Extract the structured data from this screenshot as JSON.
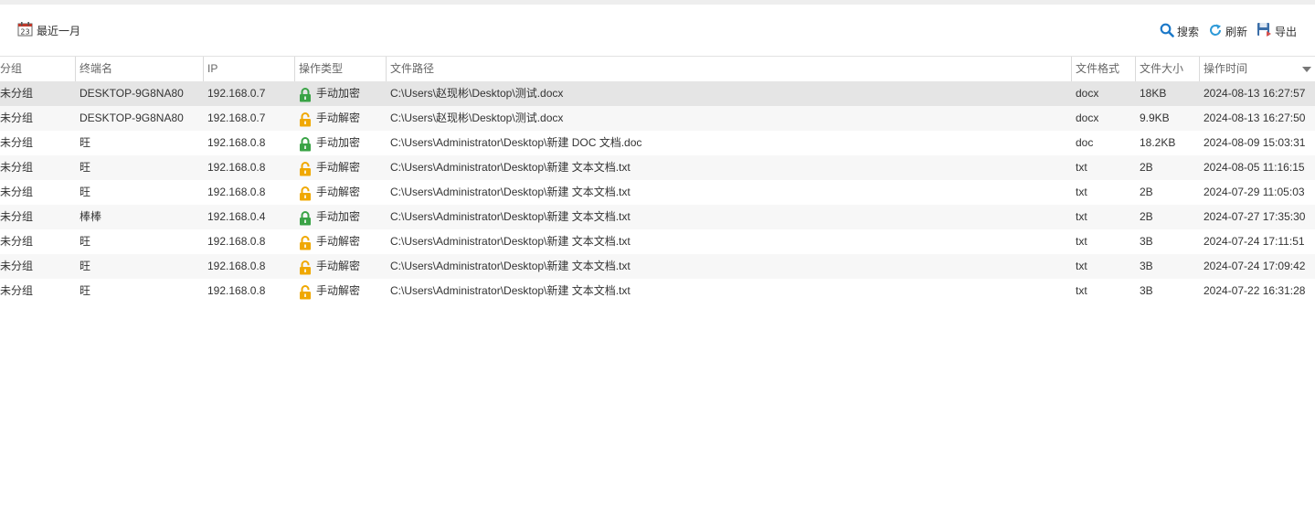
{
  "toolbar": {
    "period_label": "最近一月",
    "search_label": "搜索",
    "refresh_label": "刷新",
    "export_label": "导出"
  },
  "colors": {
    "encrypt_lock": "#3aa346",
    "decrypt_lock": "#f0a800",
    "search_icon": "#1b78c8",
    "refresh_icon": "#2e9ad8"
  },
  "table": {
    "columns": [
      "分组",
      "终端名",
      "IP",
      "操作类型",
      "文件路径",
      "文件格式",
      "文件大小",
      "操作时间"
    ],
    "sort_column": "操作时间",
    "rows": [
      {
        "group": "未分组",
        "terminal": "DESKTOP-9G8NA80",
        "ip": "192.168.0.7",
        "op": "手动加密",
        "op_icon": "lock-closed-green-icon",
        "path": "C:\\Users\\赵现彬\\Desktop\\测试.docx",
        "format": "docx",
        "size": "18KB",
        "time": "2024-08-13 16:27:57",
        "selected": true
      },
      {
        "group": "未分组",
        "terminal": "DESKTOP-9G8NA80",
        "ip": "192.168.0.7",
        "op": "手动解密",
        "op_icon": "lock-open-yellow-icon",
        "path": "C:\\Users\\赵现彬\\Desktop\\测试.docx",
        "format": "docx",
        "size": "9.9KB",
        "time": "2024-08-13 16:27:50"
      },
      {
        "group": "未分组",
        "terminal": "旺",
        "ip": "192.168.0.8",
        "op": "手动加密",
        "op_icon": "lock-closed-green-icon",
        "path": "C:\\Users\\Administrator\\Desktop\\新建 DOC 文档.doc",
        "format": "doc",
        "size": "18.2KB",
        "time": "2024-08-09 15:03:31"
      },
      {
        "group": "未分组",
        "terminal": "旺",
        "ip": "192.168.0.8",
        "op": "手动解密",
        "op_icon": "lock-open-yellow-icon",
        "path": "C:\\Users\\Administrator\\Desktop\\新建 文本文档.txt",
        "format": "txt",
        "size": "2B",
        "time": "2024-08-05 11:16:15"
      },
      {
        "group": "未分组",
        "terminal": "旺",
        "ip": "192.168.0.8",
        "op": "手动解密",
        "op_icon": "lock-open-yellow-icon",
        "path": "C:\\Users\\Administrator\\Desktop\\新建 文本文档.txt",
        "format": "txt",
        "size": "2B",
        "time": "2024-07-29 11:05:03"
      },
      {
        "group": "未分组",
        "terminal": "棒棒",
        "ip": "192.168.0.4",
        "op": "手动加密",
        "op_icon": "lock-closed-green-icon",
        "path": "C:\\Users\\Administrator\\Desktop\\新建 文本文档.txt",
        "format": "txt",
        "size": "2B",
        "time": "2024-07-27 17:35:30"
      },
      {
        "group": "未分组",
        "terminal": "旺",
        "ip": "192.168.0.8",
        "op": "手动解密",
        "op_icon": "lock-open-yellow-icon",
        "path": "C:\\Users\\Administrator\\Desktop\\新建 文本文档.txt",
        "format": "txt",
        "size": "3B",
        "time": "2024-07-24 17:11:51"
      },
      {
        "group": "未分组",
        "terminal": "旺",
        "ip": "192.168.0.8",
        "op": "手动解密",
        "op_icon": "lock-open-yellow-icon",
        "path": "C:\\Users\\Administrator\\Desktop\\新建 文本文档.txt",
        "format": "txt",
        "size": "3B",
        "time": "2024-07-24 17:09:42"
      },
      {
        "group": "未分组",
        "terminal": "旺",
        "ip": "192.168.0.8",
        "op": "手动解密",
        "op_icon": "lock-open-yellow-icon",
        "path": "C:\\Users\\Administrator\\Desktop\\新建 文本文档.txt",
        "format": "txt",
        "size": "3B",
        "time": "2024-07-22 16:31:28"
      }
    ]
  }
}
